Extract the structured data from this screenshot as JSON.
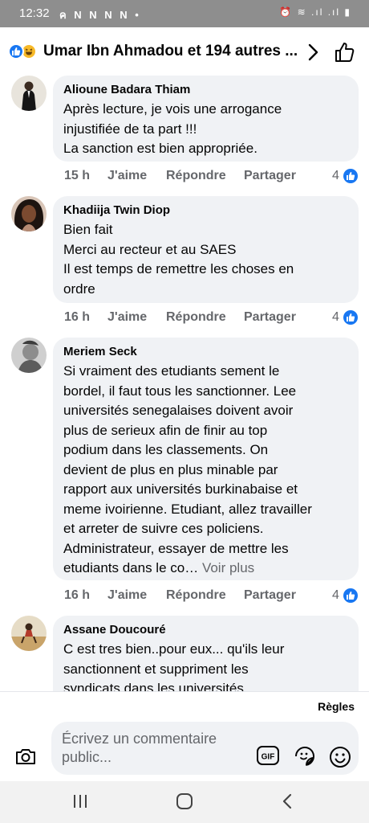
{
  "status_bar": {
    "time": "12:32",
    "left_icons": "ค N N N N •",
    "right_icons": "⏰ ≋ .ıl .ıl ▮"
  },
  "header": {
    "title": "Umar Ibn Ahmadou et 194 autres ...",
    "reaction_icons": [
      "like-icon",
      "haha-icon"
    ]
  },
  "comments": [
    {
      "author": "Alioune Badara Thiam",
      "text": "Après lecture, je vois une arrogance\ninjustifiée de ta part !!!\nLa sanction est bien appropriée.",
      "see_more": "",
      "time": "15 h",
      "like_label": "J'aime",
      "reply_label": "Répondre",
      "share_label": "Partager",
      "like_count": "4"
    },
    {
      "author": "Khadiija Twin Diop",
      "text": "Bien fait\nMerci au recteur et au SAES\nIl est temps de remettre les choses en\nordre",
      "see_more": "",
      "time": "16 h",
      "like_label": "J'aime",
      "reply_label": "Répondre",
      "share_label": "Partager",
      "like_count": "4"
    },
    {
      "author": "Meriem Seck",
      "text": "Si vraiment des etudiants sement le\nbordel, il faut tous les sanctionner. Lee\nuniversités senegalaises doivent avoir\nplus de serieux afin de finir au top\npodium dans les classements. On\ndevient de plus en plus minable par\nrapport aux universités burkinabaise et\nmeme ivoirienne. Etudiant, allez travailler\net arreter de suivre ces policiens.\nAdministrateur, essayer de mettre les\netudiants dans le co…",
      "see_more": "Voir plus",
      "time": "16 h",
      "like_label": "J'aime",
      "reply_label": "Répondre",
      "share_label": "Partager",
      "like_count": "4"
    },
    {
      "author": "Assane Doucouré",
      "text": "C est tres bien..pour eux... qu'ils leur\nsanctionnent et suppriment les\nsyndicats dans les universités",
      "see_more": ""
    }
  ],
  "composer": {
    "rules_label": "Règles",
    "placeholder": "Écrivez un commentaire\npublic...",
    "icons": [
      "camera-icon",
      "gif-icon",
      "sticker-icon",
      "emoji-icon"
    ]
  },
  "navbar": {
    "icons": [
      "recent-apps-icon",
      "home-icon",
      "back-icon"
    ]
  },
  "colors": {
    "status_bar": "#8e8e8e",
    "bubble": "#f0f2f5",
    "secondary_text": "#65676b",
    "accent_blue": "#1877f2"
  }
}
